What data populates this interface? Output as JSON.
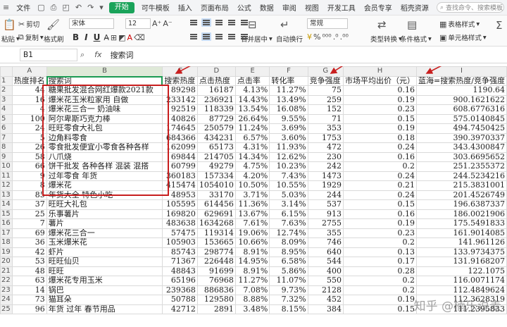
{
  "menu": {
    "file": "文件",
    "icons": [
      "save-icon",
      "print-icon",
      "preview-icon",
      "undo-icon",
      "redo-icon",
      "dropdown-icon"
    ],
    "tabs": [
      "开始",
      "可牛模板",
      "插入",
      "页面布局",
      "公式",
      "数据",
      "审阅",
      "视图",
      "开发工具",
      "会员专享",
      "稻壳资源"
    ],
    "active_tab": "开始",
    "search_placeholder": "查找命令、搜索模板"
  },
  "ribbon": {
    "paste": "粘贴",
    "cut": "剪切",
    "copy": "复制",
    "format_painter": "格式刷",
    "font": "宋体",
    "size": "12",
    "bold": "B",
    "italic": "I",
    "underline": "U",
    "merge": "合并居中",
    "wrap": "自动换行",
    "number_format": "常规",
    "type_convert": "类型转换",
    "cond_format": "条件格式",
    "table_style": "表格样式",
    "cell_style": "单元格样式"
  },
  "formula_bar": {
    "cell": "B1",
    "fx": "fx",
    "value": "搜索词"
  },
  "columns": [
    "A",
    "B",
    "C",
    "D",
    "E",
    "F",
    "G",
    "H",
    "I"
  ],
  "rows": [
    {
      "n": "1",
      "a": "热度排名",
      "b": "搜索词",
      "c": "搜索热度",
      "d": "点击热度",
      "e": "点击率",
      "f": "转化率",
      "g": "竞争强度",
      "h": "市场平均出价（元）",
      "i": "蓝海=搜索热度/竞争强度"
    },
    {
      "n": "2",
      "a": "44",
      "b": "糖果批发混合网红爆款2021款",
      "c": "89298",
      "d": "16187",
      "e": "4.13%",
      "f": "11.27%",
      "g": "75",
      "h": "0.16",
      "i": "1190.64"
    },
    {
      "n": "3",
      "a": "16",
      "b": "爆米花玉米粒家用 自做",
      "c": "233142",
      "d": "236921",
      "e": "14.43%",
      "f": "13.49%",
      "g": "259",
      "h": "0.19",
      "i": "900.1621622"
    },
    {
      "n": "4",
      "a": "4",
      "b": "爆米花三合一 奶油味",
      "c": "92519",
      "d": "118339",
      "e": "13.54%",
      "f": "16.08%",
      "g": "152",
      "h": "0.23",
      "i": "608.6776316"
    },
    {
      "n": "5",
      "a": "100",
      "b": "阿尔卑斯巧克力棒",
      "c": "40826",
      "d": "87729",
      "e": "26.64%",
      "f": "9.55%",
      "g": "71",
      "h": "0.15",
      "i": "575.0140845"
    },
    {
      "n": "6",
      "a": "24",
      "b": "旺旺零食大礼包",
      "c": "174645",
      "d": "250579",
      "e": "11.24%",
      "f": "3.69%",
      "g": "353",
      "h": "0.19",
      "i": "494.7450425"
    },
    {
      "n": "7",
      "a": "5",
      "b": "边角料零食",
      "c": "684366",
      "d": "434231",
      "e": "6.57%",
      "f": "3.60%",
      "g": "1753",
      "h": "0.18",
      "i": "390.3970337"
    },
    {
      "n": "8",
      "a": "26",
      "b": "零食批发便宜小零食各种各样",
      "c": "162099",
      "d": "65173",
      "e": "4.31%",
      "f": "11.93%",
      "g": "472",
      "h": "0.24",
      "i": "343.4300847"
    },
    {
      "n": "9",
      "a": "58",
      "b": "八爪烧",
      "c": "69844",
      "d": "214705",
      "e": "14.34%",
      "f": "12.62%",
      "g": "230",
      "h": "0.16",
      "i": "303.6695652"
    },
    {
      "n": "10",
      "a": "66",
      "b": "饼干批发 各种各样 混装 混搭",
      "c": "60799",
      "d": "49279",
      "e": "4.75%",
      "f": "10.23%",
      "g": "242",
      "h": "0.2",
      "i": "251.2355372"
    },
    {
      "n": "11",
      "a": "9",
      "b": "过年零食 年货",
      "c": "360183",
      "d": "157334",
      "e": "4.20%",
      "f": "7.43%",
      "g": "1473",
      "h": "0.24",
      "i": "244.5234216"
    },
    {
      "n": "12",
      "a": "8",
      "b": "爆米花",
      "c": "415474",
      "d": "1054010",
      "e": "10.50%",
      "f": "10.55%",
      "g": "1929",
      "h": "0.21",
      "i": "215.3831001"
    },
    {
      "n": "13",
      "a": "85",
      "b": "年货大全 特色小吃",
      "c": "48953",
      "d": "33170",
      "e": "3.71%",
      "f": "5.03%",
      "g": "244",
      "h": "0.24",
      "i": "201.4526749"
    },
    {
      "n": "14",
      "a": "37",
      "b": "旺旺大礼包",
      "c": "105595",
      "d": "614456",
      "e": "11.36%",
      "f": "3.14%",
      "g": "537",
      "h": "0.15",
      "i": "196.6387337"
    },
    {
      "n": "15",
      "a": "25",
      "b": "乐事薯片",
      "c": "169820",
      "d": "629691",
      "e": "13.67%",
      "f": "6.15%",
      "g": "913",
      "h": "0.16",
      "i": "186.0021906"
    },
    {
      "n": "16",
      "a": "7",
      "b": "薯片",
      "c": "483638",
      "d": "1634268",
      "e": "7.61%",
      "f": "7.63%",
      "g": "2755",
      "h": "0.19",
      "i": "175.5491833"
    },
    {
      "n": "17",
      "a": "69",
      "b": "爆米花三合一",
      "c": "57475",
      "d": "119314",
      "e": "19.06%",
      "f": "12.74%",
      "g": "355",
      "h": "0.23",
      "i": "161.9014085"
    },
    {
      "n": "18",
      "a": "36",
      "b": "玉米爆米花",
      "c": "105903",
      "d": "153665",
      "e": "10.66%",
      "f": "8.09%",
      "g": "746",
      "h": "0.2",
      "i": "141.961126"
    },
    {
      "n": "19",
      "a": "42",
      "b": "虾片",
      "c": "85743",
      "d": "298774",
      "e": "8.91%",
      "f": "8.95%",
      "g": "640",
      "h": "0.13",
      "i": "133.9734375"
    },
    {
      "n": "20",
      "a": "53",
      "b": "旺旺仙贝",
      "c": "71367",
      "d": "226448",
      "e": "14.95%",
      "f": "6.58%",
      "g": "544",
      "h": "0.17",
      "i": "131.9168207"
    },
    {
      "n": "21",
      "a": "48",
      "b": "旺旺",
      "c": "48843",
      "d": "91699",
      "e": "8.91%",
      "f": "5.86%",
      "g": "400",
      "h": "0.28",
      "i": "122.1075"
    },
    {
      "n": "22",
      "a": "63",
      "b": "爆米花专用玉米",
      "c": "65196",
      "d": "76968",
      "e": "11.27%",
      "f": "11.07%",
      "g": "550",
      "h": "0.2",
      "i": "116.0071174"
    },
    {
      "n": "23",
      "a": "14",
      "b": "锅巴",
      "c": "239368",
      "d": "886836",
      "e": "7.08%",
      "f": "9.73%",
      "g": "2128",
      "h": "0.2",
      "i": "112.4849624"
    },
    {
      "n": "24",
      "a": "73",
      "b": "猫耳朵",
      "c": "50788",
      "d": "129580",
      "e": "8.88%",
      "f": "7.32%",
      "g": "452",
      "h": "0.19",
      "i": "112.3628319"
    },
    {
      "n": "25",
      "a": "96",
      "b": "年货 过年 春节用品",
      "c": "42712",
      "d": "2891",
      "e": "3.48%",
      "f": "8.15%",
      "g": "384",
      "h": "0.15",
      "i": "111.2395833"
    }
  ],
  "watermark": "知乎 @楠乐说麦",
  "colors": {
    "accent": "#1aa35a",
    "highlight": "#c81e1e"
  }
}
